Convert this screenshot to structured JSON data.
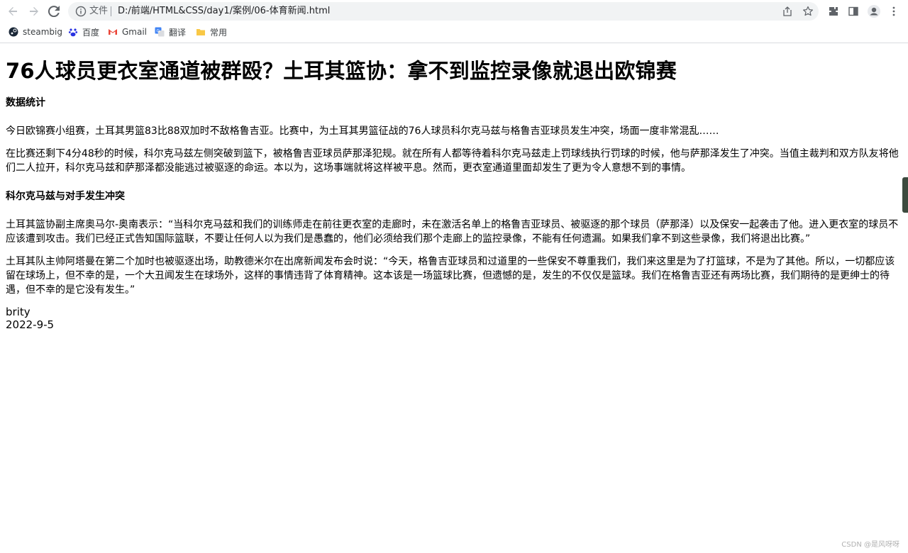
{
  "browser": {
    "file_label": "文件",
    "url": "D:/前端/HTML&CSS/day1/案例/06-体育新闻.html",
    "bookmarks": [
      {
        "label": "steambig",
        "icon": "steam-icon"
      },
      {
        "label": "百度",
        "icon": "baidu-icon"
      },
      {
        "label": "Gmail",
        "icon": "gmail-icon"
      },
      {
        "label": "翻译",
        "icon": "translate-icon"
      },
      {
        "label": "常用",
        "icon": "folder-icon"
      }
    ]
  },
  "article": {
    "title": "76人球员更衣室通道被群殴？土耳其篮协：拿不到监控录像就退出欧锦赛",
    "section1_heading": "数据统计",
    "para1": "今日欧锦赛小组赛，土耳其男篮83比88双加时不敌格鲁吉亚。比赛中，为土耳其男篮征战的76人球员科尔克马兹与格鲁吉亚球员发生冲突，场面一度非常混乱……",
    "para2": "在比赛还剩下4分48秒的时候，科尔克马兹左侧突破到篮下，被格鲁吉亚球员萨那泽犯规。就在所有人都等待着科尔克马兹走上罚球线执行罚球的时候，他与萨那泽发生了冲突。当值主裁判和双方队友将他们二人拉开，科尔克马兹和萨那泽都没能逃过被驱逐的命运。本以为，这场事端就将这样被平息。然而，更衣室通道里面却发生了更为令人意想不到的事情。",
    "section2_heading": "科尔克马兹与对手发生冲突",
    "para3": "土耳其篮协副主席奥马尔-奥南表示：“当科尔克马兹和我们的训练师走在前往更衣室的走廊时，未在激活名单上的格鲁吉亚球员、被驱逐的那个球员（萨那泽）以及保安一起袭击了他。进入更衣室的球员不应该遭到攻击。我们已经正式告知国际篮联，不要让任何人以为我们是愚蠢的，他们必须给我们那个走廊上的监控录像，不能有任何遗漏。如果我们拿不到这些录像，我们将退出比赛。”",
    "para4": "土耳其队主帅阿塔曼在第二个加时也被驱逐出场，助教德米尔在出席新闻发布会时说：“今天，格鲁吉亚球员和过道里的一些保安不尊重我们，我们来这里是为了打篮球，不是为了其他。所以，一切都应该留在球场上，但不幸的是，一个大丑闻发生在球场外，这样的事情违背了体育精神。这本该是一场篮球比赛，但遗憾的是，发生的不仅仅是篮球。我们在格鲁吉亚还有两场比赛，我们期待的是更绅士的待遇，但不幸的是它没有发生。”",
    "author": "brity",
    "date": "2022-9-5"
  },
  "watermark": "CSDN @是风呀呀"
}
